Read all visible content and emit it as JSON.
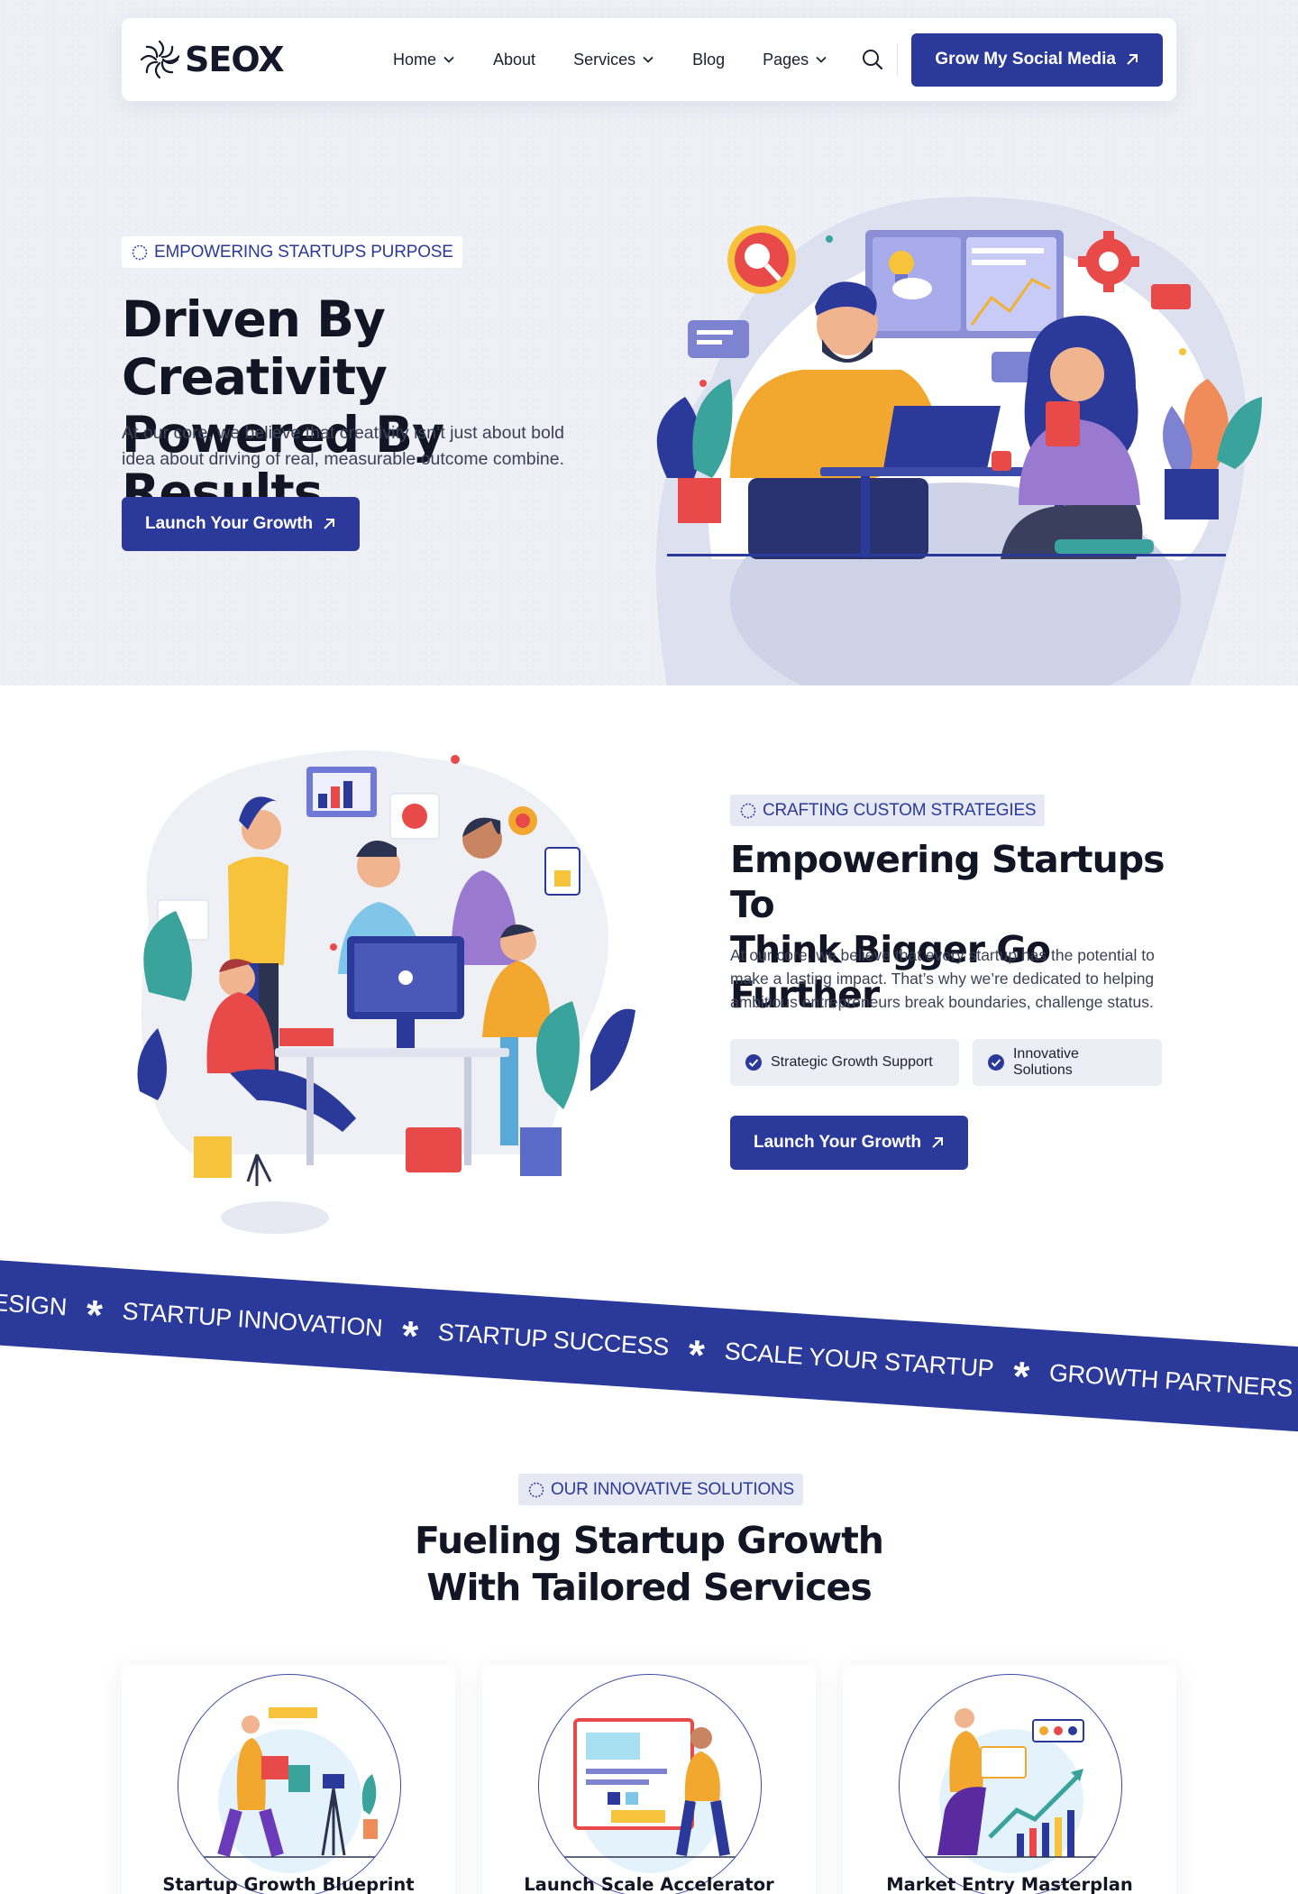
{
  "nav": {
    "logo_text": "SEOX",
    "menu": [
      {
        "label": "Home",
        "has_dropdown": true
      },
      {
        "label": "About",
        "has_dropdown": false
      },
      {
        "label": "Services",
        "has_dropdown": true
      },
      {
        "label": "Blog",
        "has_dropdown": false
      },
      {
        "label": "Pages",
        "has_dropdown": true
      }
    ],
    "search_icon": "search-icon",
    "cta_label": "Grow My Social Media"
  },
  "hero": {
    "badge": "EMPOWERING STARTUPS PURPOSE",
    "title_line1": "Driven By Creativity",
    "title_line2": "Powered By Results",
    "para_line1": "At our core, we believe that creativity isn’t just about bold",
    "para_line2": "idea about driving of real, measurable outcome combine.",
    "cta_label": "Launch Your Growth"
  },
  "strategies": {
    "badge": "CRAFTING CUSTOM STRATEGIES",
    "title_line1": "Empowering Startups To",
    "title_line2": "Think Bigger Go Further",
    "para_line1": "At our core, we believe that every startup has the potential to",
    "para_line2": "make a lasting impact. That’s why we’re dedicated to helping",
    "para_line3": "ambitious entrepreneurs break boundaries, challenge status.",
    "features": [
      "Strategic Growth Support",
      "Innovative Solutions"
    ],
    "cta_label": "Launch Your Growth"
  },
  "ticker": {
    "items": [
      "ESIGN",
      "STARTUP INNOVATION",
      "STARTUP SUCCESS",
      "SCALE YOUR STARTUP",
      "GROWTH PARTNERS"
    ]
  },
  "solutions": {
    "badge": "OUR INNOVATIVE SOLUTIONS",
    "title_line1": "Fueling Startup Growth",
    "title_line2": "With Tailored Services",
    "cards": [
      {
        "title": "Startup Growth Blueprint"
      },
      {
        "title": "Launch Scale Accelerator"
      },
      {
        "title": "Market Entry Masterplan"
      }
    ]
  },
  "colors": {
    "accent": "#2b3a9a",
    "hero_bg": "#eef0f6",
    "ink": "#121624"
  }
}
